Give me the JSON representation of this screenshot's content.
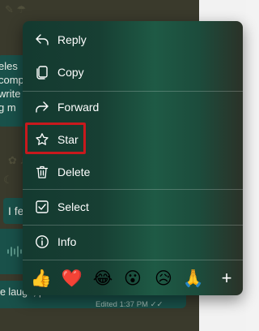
{
  "background_chat": {
    "bubble1_lines": [
      "eles",
      "comp",
      "write",
      "g m"
    ],
    "bubble2_text": "I fe",
    "bubble4_text": "e laugh, please",
    "bubble4_meta": "Edited 1:37 PM ✓✓"
  },
  "menu": {
    "items": [
      {
        "label": "Reply",
        "icon": "reply-icon"
      },
      {
        "label": "Copy",
        "icon": "copy-icon"
      },
      {
        "label": "Forward",
        "icon": "forward-icon"
      },
      {
        "label": "Star",
        "icon": "star-icon"
      },
      {
        "label": "Delete",
        "icon": "trash-icon"
      },
      {
        "label": "Select",
        "icon": "checkbox-icon"
      },
      {
        "label": "Info",
        "icon": "info-icon"
      }
    ],
    "highlighted_item": "Star",
    "highlight_color": "#c8191d"
  },
  "reactions": {
    "emojis": [
      "👍",
      "❤️",
      "😂",
      "😮",
      "😥",
      "🙏"
    ],
    "more_label": "+"
  },
  "colors": {
    "menu_bg": "#1b4a3b",
    "bubble_bg": "#19514a",
    "chat_bg": "#3a3a2c"
  }
}
